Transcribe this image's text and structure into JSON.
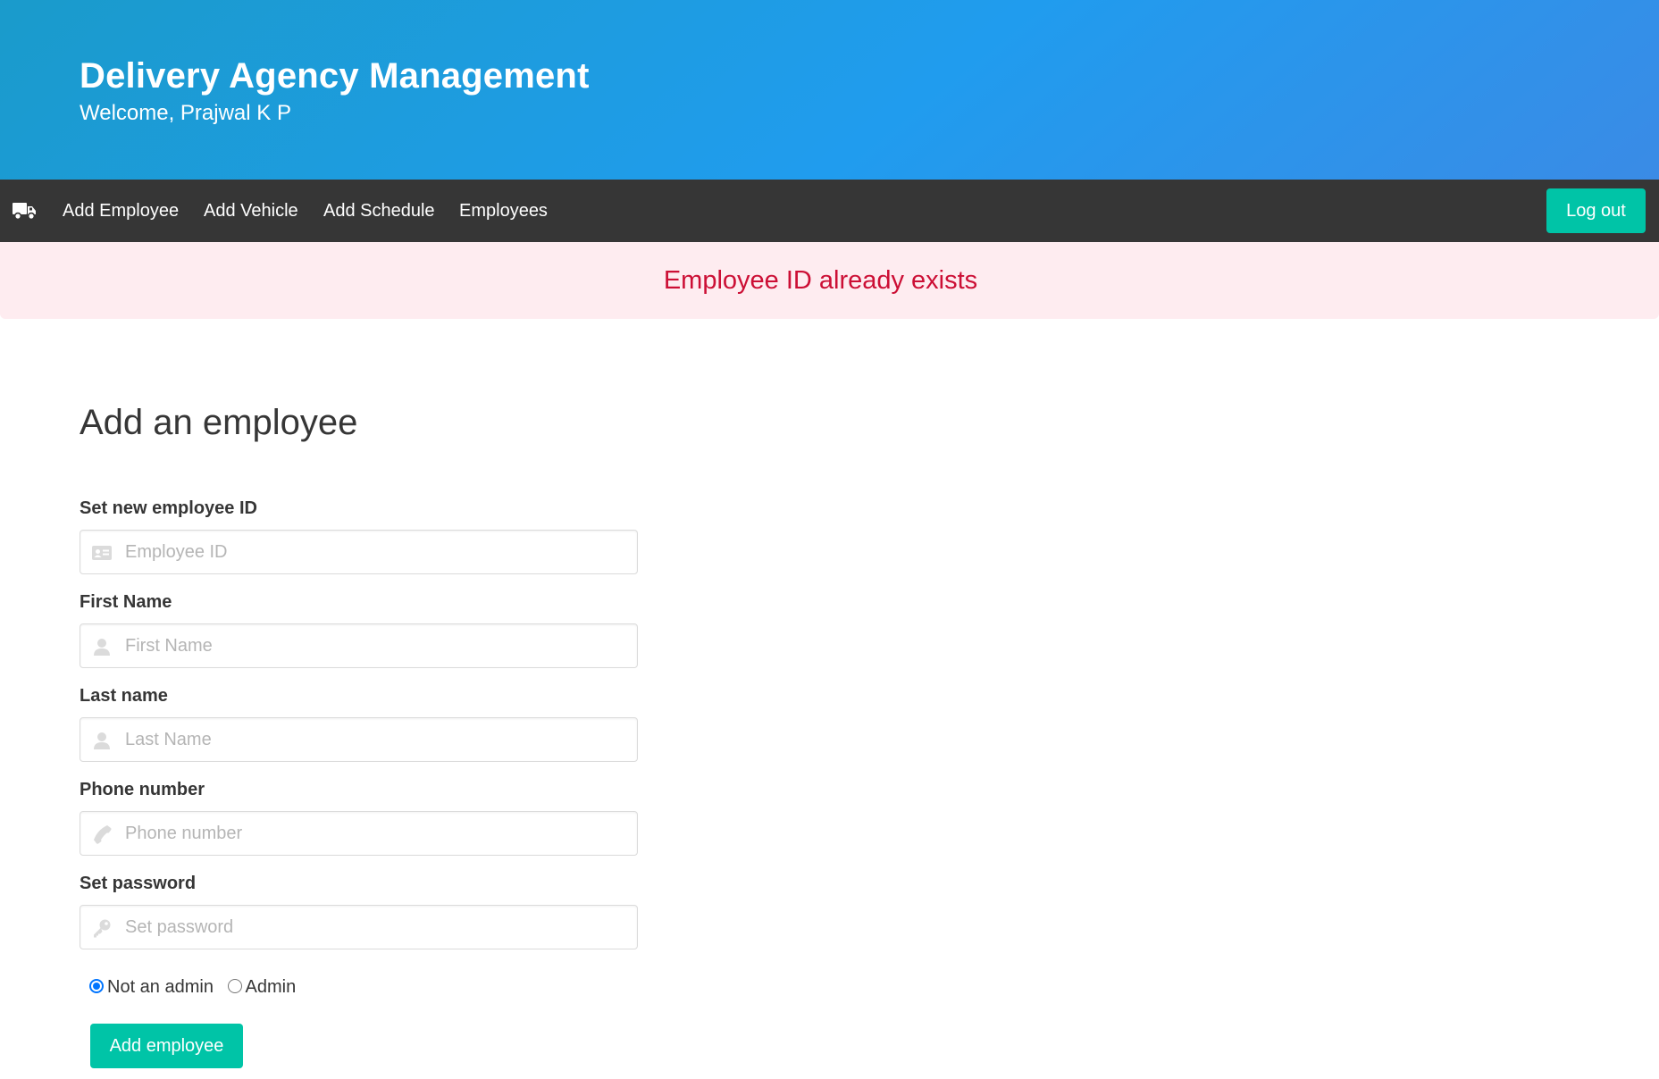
{
  "header": {
    "title": "Delivery Agency Management",
    "subtitle": "Welcome, Prajwal K P"
  },
  "navbar": {
    "logo_icon": "truck-icon",
    "items": [
      {
        "label": "Add Employee"
      },
      {
        "label": "Add Vehicle"
      },
      {
        "label": "Add Schedule"
      },
      {
        "label": "Employees"
      }
    ],
    "logout_label": "Log out"
  },
  "notification": {
    "message": "Employee ID already exists"
  },
  "form": {
    "title": "Add an employee",
    "fields": [
      {
        "label": "Set new employee ID",
        "placeholder": "Employee ID",
        "value": "",
        "icon": "id-card-icon"
      },
      {
        "label": "First Name",
        "placeholder": "First Name",
        "value": "",
        "icon": "user-icon"
      },
      {
        "label": "Last name",
        "placeholder": "Last Name",
        "value": "",
        "icon": "user-icon"
      },
      {
        "label": "Phone number",
        "placeholder": "Phone number",
        "value": "",
        "icon": "phone-icon"
      },
      {
        "label": "Set password",
        "placeholder": "Set password",
        "value": "",
        "icon": "key-icon"
      }
    ],
    "role_options": [
      {
        "label": "Not an admin",
        "selected": true
      },
      {
        "label": "Admin",
        "selected": false
      }
    ],
    "submit_label": "Add employee"
  },
  "colors": {
    "hero_gradient_start": "#1a9bcb",
    "hero_gradient_end": "#3a8be6",
    "navbar_bg": "#363636",
    "accent": "#00c4a7",
    "danger_bg": "#feecf0",
    "danger_text": "#cc0f35"
  }
}
